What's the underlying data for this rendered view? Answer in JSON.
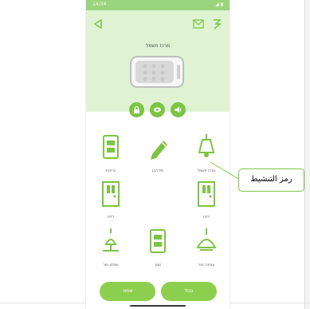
{
  "status_bar": {
    "time": "14:34",
    "icons": "◢ ▮"
  },
  "header": {
    "back_icon": "back-triangle-icon",
    "mail_icon": "mail-icon",
    "logo_icon": "app-logo-icon"
  },
  "device": {
    "name": "מרכז חשמל",
    "buttons": [
      "lock-icon",
      "eye-icon",
      "speaker-icon"
    ]
  },
  "grid": {
    "items": [
      {
        "label": "מרכז חשמל",
        "icon": "ceiling-lamp-icon"
      },
      {
        "label": "תל הבן",
        "icon": "pencil-icon"
      },
      {
        "label": "בריכות",
        "icon": "wall-switch-icon"
      },
      {
        "label": "דלת",
        "icon": "door-icon"
      },
      {
        "label": "דלת",
        "icon": "door-icon"
      },
      {
        "label": "עמידה סור",
        "icon": "pendant-lamp-icon"
      },
      {
        "label": "מסך",
        "icon": "wall-switch-icon"
      },
      {
        "label": "שולחן סור",
        "icon": "table-lamp-icon"
      }
    ]
  },
  "bottom": {
    "left_button": "שמור",
    "right_button": "בטל"
  },
  "callout": {
    "text": "رمز التنشيط"
  },
  "colors": {
    "accent": "#7cc444",
    "panel_background": "#dff3d3",
    "status_bar": "#9ad47c"
  }
}
